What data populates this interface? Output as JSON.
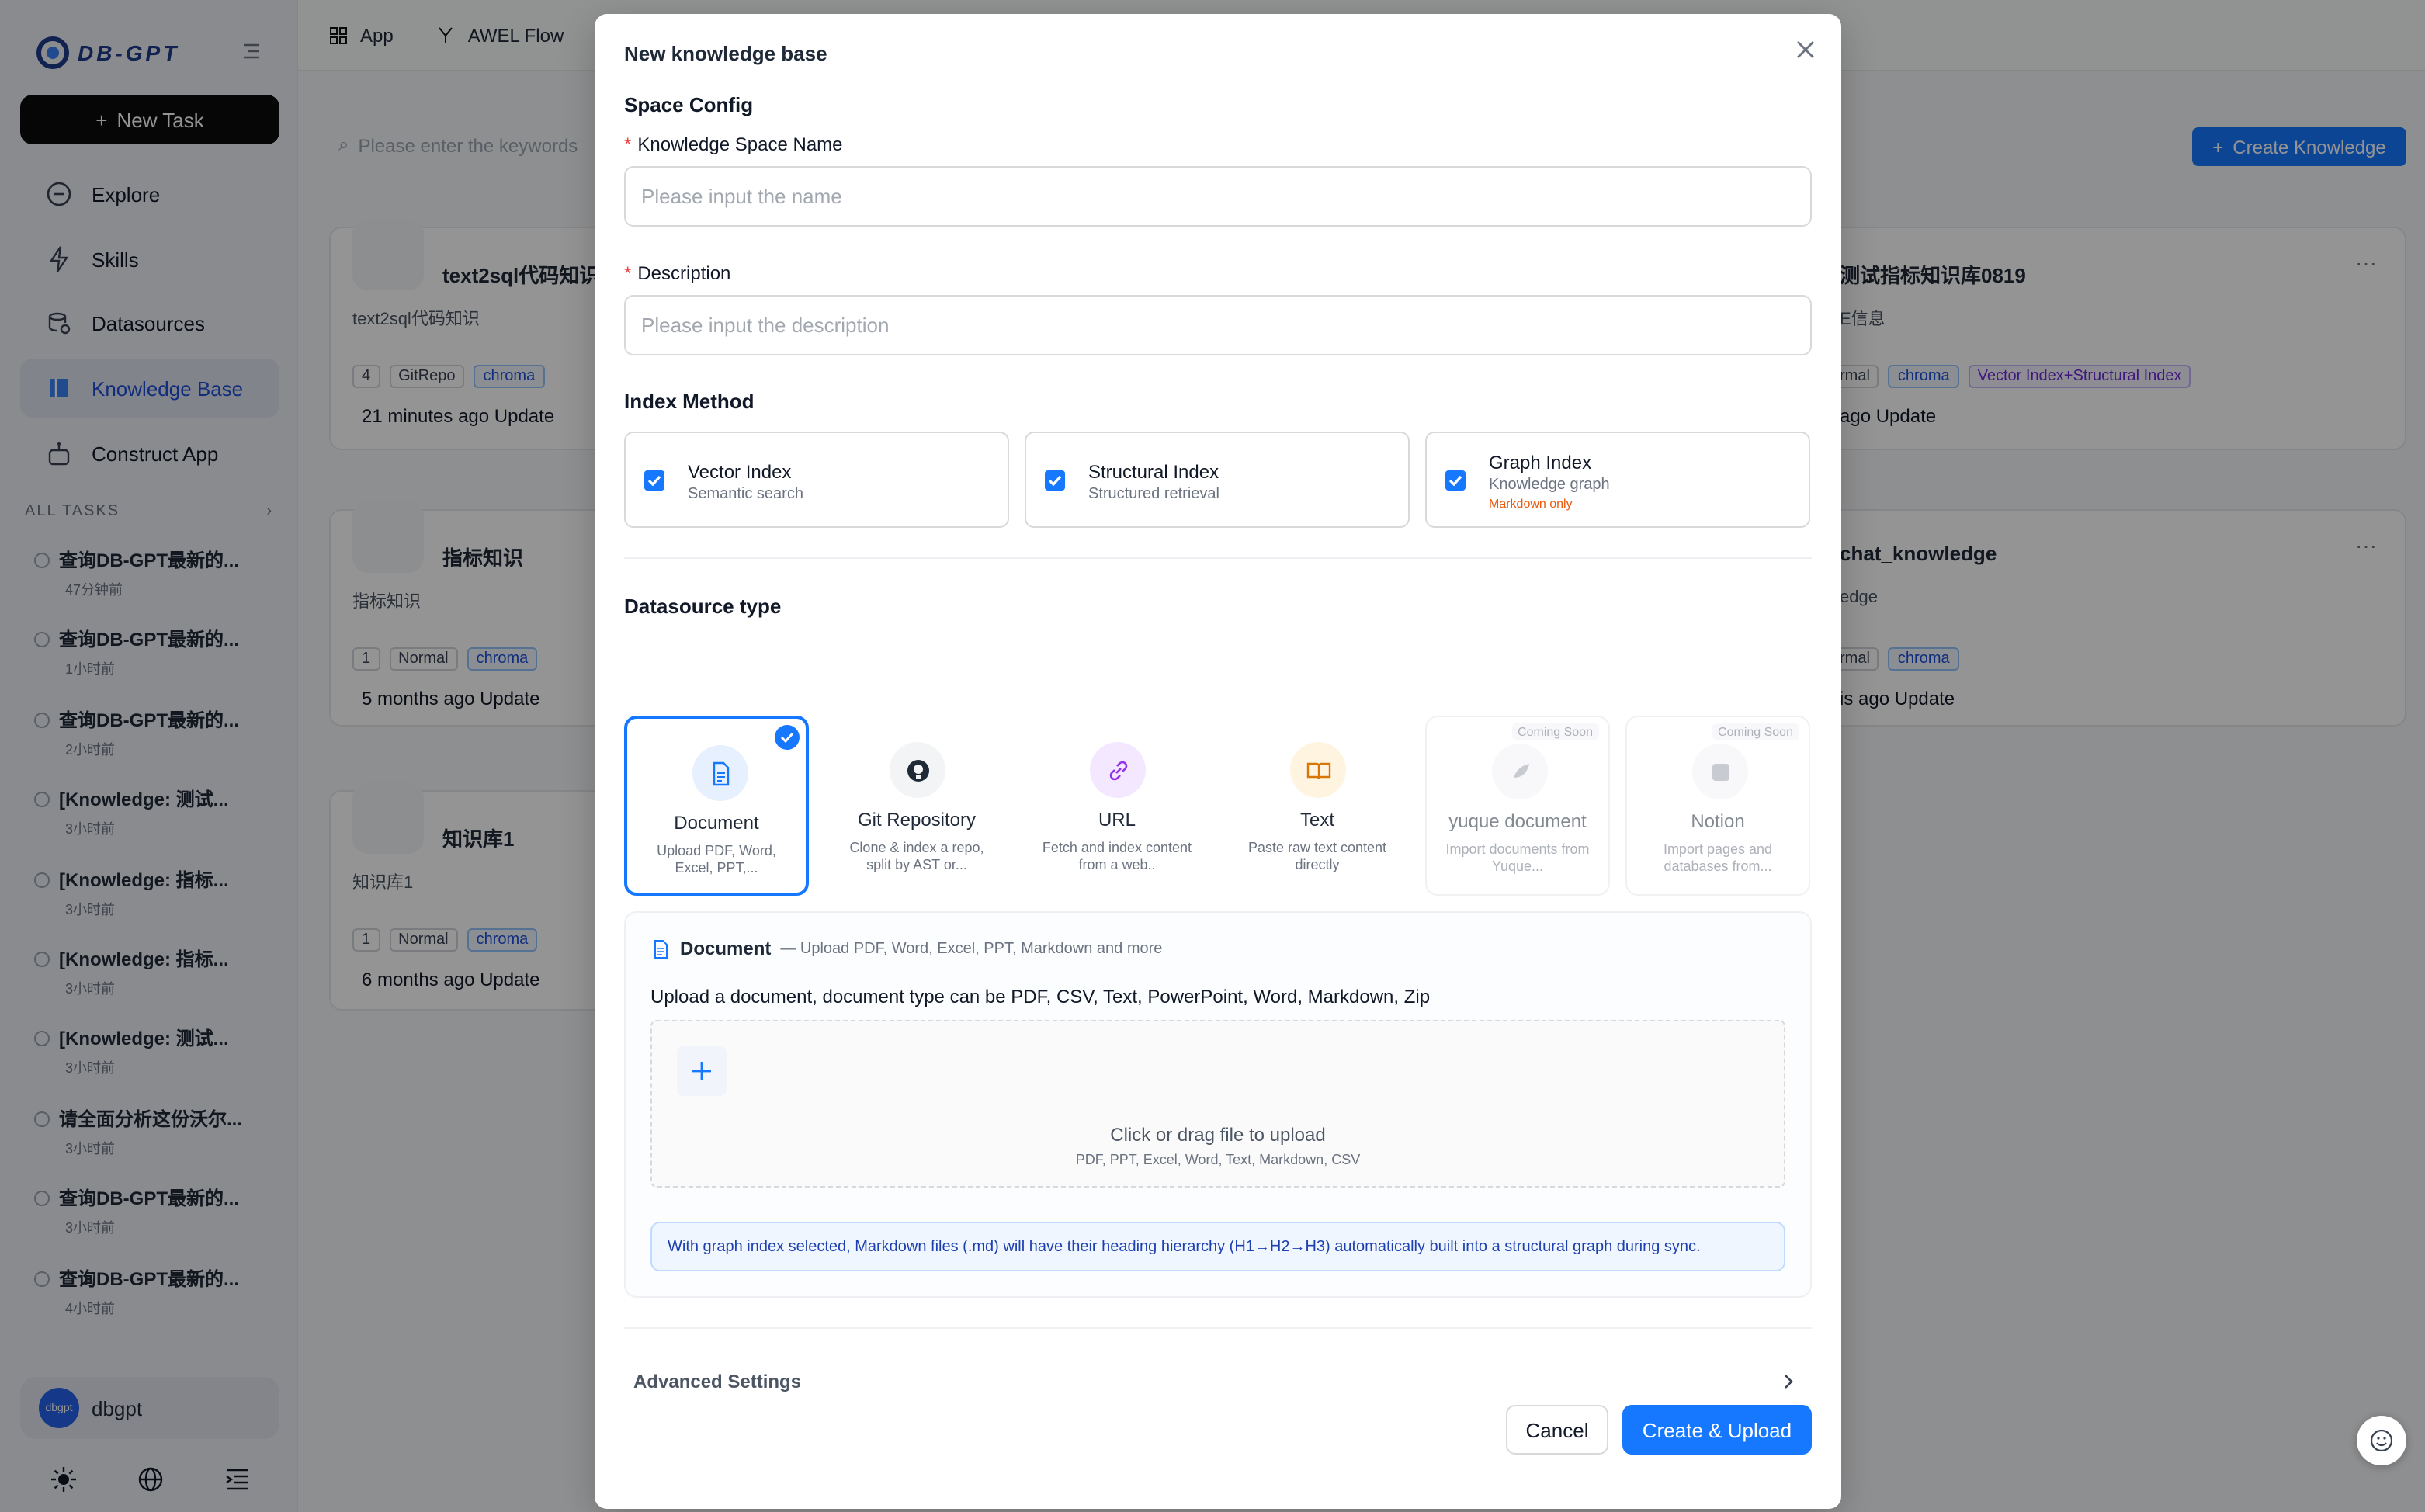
{
  "sidebar": {
    "logo_text": "DB-GPT",
    "new_task": "New Task",
    "items": [
      {
        "label": "Explore",
        "icon": "compass-icon"
      },
      {
        "label": "Skills",
        "icon": "lightning-icon"
      },
      {
        "label": "Datasources",
        "icon": "database-icon"
      },
      {
        "label": "Knowledge Base",
        "icon": "book-icon",
        "active": true
      },
      {
        "label": "Construct App",
        "icon": "robot-icon"
      }
    ],
    "all_tasks": "ALL TASKS",
    "tasks": [
      {
        "title": "查询DB-GPT最新的...",
        "time": "47分钟前"
      },
      {
        "title": "查询DB-GPT最新的...",
        "time": "1小时前"
      },
      {
        "title": "查询DB-GPT最新的...",
        "time": "2小时前"
      },
      {
        "title": "[Knowledge: 测试...",
        "time": "3小时前"
      },
      {
        "title": "[Knowledge: 指标...",
        "time": "3小时前"
      },
      {
        "title": "[Knowledge: 指标...",
        "time": "3小时前"
      },
      {
        "title": "[Knowledge: 测试...",
        "time": "3小时前"
      },
      {
        "title": "请全面分析这份沃尔...",
        "time": "3小时前"
      },
      {
        "title": "查询DB-GPT最新的...",
        "time": "3小时前"
      },
      {
        "title": "查询DB-GPT最新的...",
        "time": "4小时前"
      }
    ],
    "user": {
      "avatar": "dbgpt",
      "name": "dbgpt"
    }
  },
  "topbar": {
    "app": "App",
    "awel": "AWEL Flow"
  },
  "background": {
    "search_placeholder": "Please enter the keywords",
    "create_button": "Create Knowledge",
    "cards": [
      {
        "title": "text2sql代码知识",
        "sub": "text2sql代码知识",
        "count": "4",
        "type": "GitRepo",
        "store": "chroma",
        "update": "21 minutes ago Update"
      },
      {
        "title": "指标知识",
        "sub": "指标知识",
        "count": "1",
        "type": "Normal",
        "store": "chroma",
        "update": "5 months ago Update"
      },
      {
        "title": "知识库1",
        "sub": "知识库1",
        "count": "1",
        "type": "Normal",
        "store": "chroma",
        "update": "6 months ago Update"
      },
      {
        "title": "测试指标知识库0819",
        "sub": "E信息",
        "type": "rmal",
        "store": "chroma",
        "extra": "Vector Index+Structural Index",
        "update": "ago Update"
      },
      {
        "title": "chat_knowledge",
        "sub": "edge",
        "type": "rmal",
        "store": "chroma",
        "update": "is ago Update"
      }
    ]
  },
  "modal": {
    "title": "New knowledge base",
    "space_config": "Space Config",
    "name_label": "Knowledge Space Name",
    "name_placeholder": "Please input the name",
    "desc_label": "Description",
    "desc_placeholder": "Please input the description",
    "index_method": "Index Method",
    "indexes": [
      {
        "name": "Vector Index",
        "sub": "Semantic search",
        "checked": true
      },
      {
        "name": "Structural Index",
        "sub": "Structured retrieval",
        "checked": true
      },
      {
        "name": "Graph Index",
        "sub": "Knowledge graph",
        "warn": "Markdown only",
        "checked": true
      }
    ],
    "datasource_type": "Datasource type",
    "datasources": [
      {
        "name": "Document",
        "desc": "Upload PDF, Word, Excel, PPT,...",
        "icon": "document-icon",
        "selected": true
      },
      {
        "name": "Git Repository",
        "desc": "Clone & index a repo, split by AST or...",
        "icon": "github-icon"
      },
      {
        "name": "URL",
        "desc": "Fetch and index content from a web..",
        "icon": "link-icon"
      },
      {
        "name": "Text",
        "desc": "Paste raw text content directly",
        "icon": "open-book-icon"
      },
      {
        "name": "yuque document",
        "desc": "Import documents from Yuque...",
        "icon": "yuque-icon",
        "badge": "Coming Soon"
      },
      {
        "name": "Notion",
        "desc": "Import pages and databases from...",
        "icon": "notion-icon",
        "badge": "Coming Soon"
      }
    ],
    "doc_panel": {
      "title": "Document",
      "subtitle": "— Upload PDF, Word, Excel, PPT, Markdown and more",
      "desc": "Upload a document, document type can be PDF, CSV, Text, PowerPoint, Word, Markdown, Zip",
      "drop_text": "Click or drag file to upload",
      "drop_types": "PDF, PPT, Excel, Word, Text, Markdown, CSV",
      "note": "With graph index selected, Markdown files (.md) will have their heading hierarchy (H1→H2→H3) automatically built into a structural graph during sync."
    },
    "advanced": "Advanced Settings",
    "cancel": "Cancel",
    "create": "Create & Upload"
  },
  "colors": {
    "primary": "#1677ff",
    "sidebar_bg": "#eef0f5",
    "warn": "#ea580c"
  }
}
